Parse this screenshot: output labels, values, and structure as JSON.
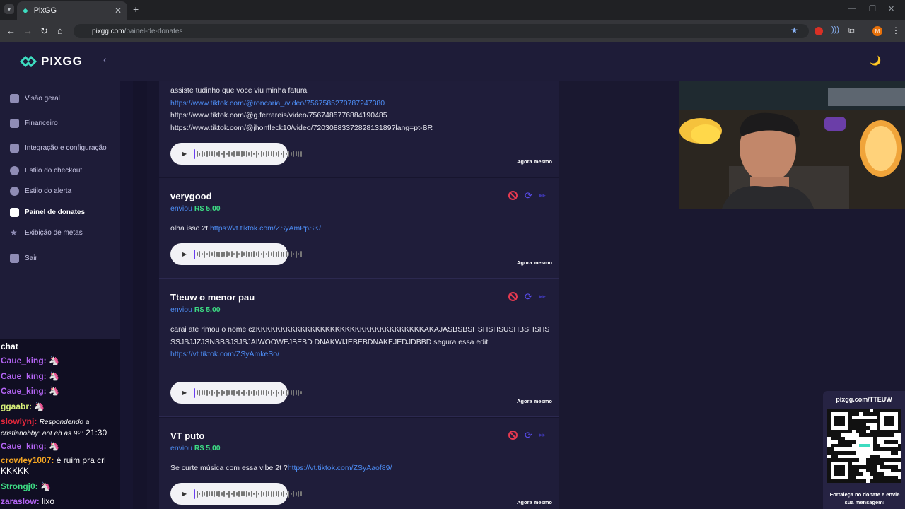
{
  "browser": {
    "tab_title": "PixGG",
    "url_domain": "pixgg.com",
    "url_path": "/painel-de-donates",
    "profile_initial": "M"
  },
  "sidebar": {
    "brand": "PIXGG",
    "items": [
      {
        "label": "Visão geral",
        "icon": "home-icon"
      },
      {
        "label": "Financeiro",
        "icon": "wallet-icon"
      },
      {
        "label": "Integração e configuração",
        "icon": "integration-icon"
      },
      {
        "label": "Estilo do checkout",
        "icon": "palette-icon"
      },
      {
        "label": "Estilo do alerta",
        "icon": "palette-icon"
      },
      {
        "label": "Painel de donates",
        "icon": "donate-icon",
        "active": true
      },
      {
        "label": "Exibição de metas",
        "icon": "star-icon"
      },
      {
        "label": "Sair",
        "icon": "logout-icon"
      }
    ]
  },
  "donations": [
    {
      "name": "",
      "sent_label": "",
      "amount": "",
      "message_lines": [
        {
          "text": "assiste tudinho que voce viu minha fatura",
          "link": false
        },
        {
          "text": "https://www.tiktok.com/@roncaria_/video/7567585270787247380",
          "link": true
        },
        {
          "text": "https://www.tiktok.com/@g.ferrareis/video/7567485776884190485",
          "link": false
        },
        {
          "text": "https://www.tiktok.com/@jhonfleck10/video/7203088337282813189?lang=pt-BR",
          "link": false
        }
      ],
      "time": "Agora mesmo"
    },
    {
      "name": "verygood",
      "sent_label": "enviou",
      "amount": "R$ 5,00",
      "message_text": "olha isso 2t ",
      "message_link": "https://vt.tiktok.com/ZSyAmPpSK/",
      "time": "Agora mesmo"
    },
    {
      "name": "Tteuw o menor pau",
      "sent_label": "enviou",
      "amount": "R$ 5,00",
      "message_text": "carai ate rimou o nome czKKKKKKKKKKKKKKKKKKKKKKKKKKKKKKKKKKAKAJASBSBSHSHSHSUSHBSHSHSSSJSJJZJSNSBSJSJSJAIWOOWEJBEBD DNAKWIJEBEBDNAKEJEDJDBBD segura essa edit",
      "message_link": "https://vt.tiktok.com/ZSyAmkeSo/",
      "time": "Agora mesmo"
    },
    {
      "name": "VT puto",
      "sent_label": "enviou",
      "amount": "R$ 5,00",
      "message_text": "Se curte música com essa vibe 2t ?",
      "message_link": "https://vt.tiktok.com/ZSyAaof89/",
      "time": "Agora mesmo"
    }
  ],
  "chat": [
    {
      "user": "chat",
      "color": "#ffffff",
      "msg": ""
    },
    {
      "user": "Caue_king:",
      "color": "#b565f5",
      "msg": "🦄"
    },
    {
      "user": "Caue_king:",
      "color": "#b565f5",
      "msg": "🦄"
    },
    {
      "user": "Caue_king:",
      "color": "#b565f5",
      "msg": "🦄"
    },
    {
      "user": "ggaabr:",
      "color": "#d8f07a",
      "msg": "🦄"
    },
    {
      "user": "slowlynj:",
      "color": "#e8283c",
      "reply": "Respondendo a cristianobby: aot eh as 9?:",
      "msg": "21:30"
    },
    {
      "user": "Caue_king:",
      "color": "#b565f5",
      "msg": "🦄"
    },
    {
      "user": "crowley1007:",
      "color": "#f5a623",
      "msg": "é ruim pra crl KKKKK"
    },
    {
      "user": "Strongj0:",
      "color": "#3ddc84",
      "msg": "🦄"
    },
    {
      "user": "zaraslow:",
      "color": "#b565f5",
      "msg": "lixo"
    }
  ],
  "qr": {
    "url": "pixgg.com/TTEUW",
    "caption": "Fortaleça no donate e envie sua mensagem!"
  },
  "colors": {
    "accent_blue": "#4d8df5",
    "amount_green": "#3ddc84",
    "block_red": "#e53950",
    "replay_purple": "#5a4df0"
  }
}
